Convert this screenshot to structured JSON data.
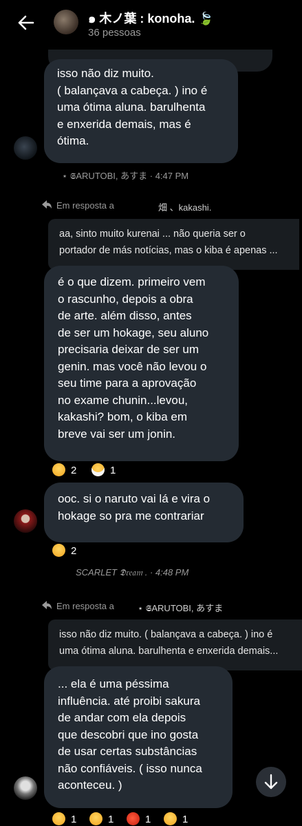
{
  "header": {
    "title": "๑ 木ノ葉 : konoha. 🍃",
    "subtitle": "36 pessoas"
  },
  "messages": [
    {
      "text": "isso não diz muito.\n( balançava a cabeça. ) ino é\numa ótima aluna. barulhenta\ne enxerida demais, mas é\nótima.",
      "meta": "⋆ 𝕾ARUTOBI, あすま · 4:47 PM"
    },
    {
      "reply_label": "Em resposta a",
      "reply_to": "畑 、kakashi.",
      "quote": "aa, sinto muito kurenai ... não queria ser o\nportador de más notícias, mas o kiba é apenas ...",
      "text": "é o que dizem. primeiro vem\no rascunho, depois a obra\nde arte. além disso, antes\nde ser um hokage, seu aluno\nprecisaria deixar de ser um\ngenin. mas você não levou o\nseu time para a aprovação\nno exame chunin...levou,\nkakashi?  bom, o kiba em\nbreve vai ser um jonin.",
      "reactions": [
        {
          "icon": "laughing-emoji",
          "count": "2"
        },
        {
          "icon": "mask-emoji",
          "count": "1"
        }
      ]
    },
    {
      "text": "ooc. si o naruto vai lá e vira o\nhokage so pra me contrariar",
      "reactions": [
        {
          "icon": "laughing-emoji",
          "count": "2"
        }
      ],
      "meta": "SCARLET  𝕯𝔯𝔢𝔞𝔪 . · 4:48 PM"
    },
    {
      "reply_label": "Em resposta a",
      "reply_to": "⋆ 𝕾ARUTOBI, あすま",
      "quote": "isso não diz muito. ( balançava a cabeça. ) ino é\numa ótima aluna. barulhenta e enxerida demais...",
      "text": "... ela é uma péssima\ninfluência. até proibi sakura\nde andar com ela depois\nque descobri que ino gosta\nde usar certas substâncias\nnão confiáveis. ( isso nunca\naconteceu. )",
      "reactions": [
        {
          "icon": "relieved-emoji",
          "count": "1"
        },
        {
          "icon": "smiling-emoji",
          "count": "1"
        },
        {
          "icon": "tomato-emoji",
          "count": "1"
        },
        {
          "icon": "laughing-emoji",
          "count": "1"
        }
      ]
    }
  ]
}
